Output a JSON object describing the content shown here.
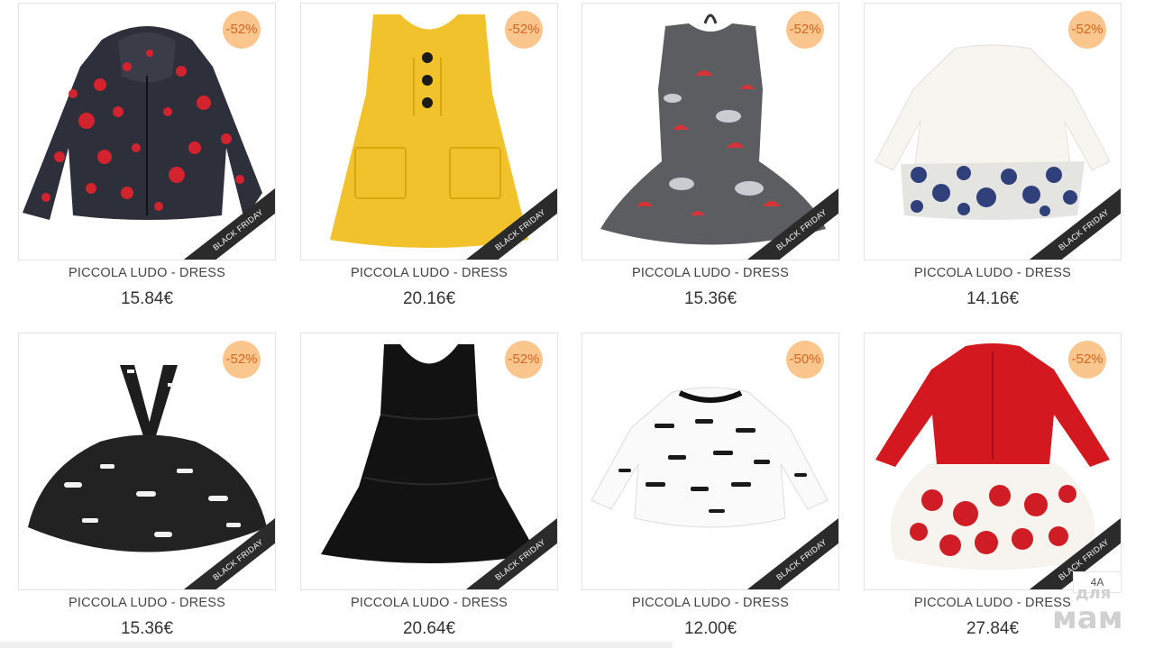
{
  "products": [
    {
      "title": "PICCOLA LUDO - DRESS",
      "price": "15.84€",
      "discount": "-52%",
      "ribbon": "BLACK FRIDAY",
      "image": "polka-dot-hoodie"
    },
    {
      "title": "PICCOLA LUDO - DRESS",
      "price": "20.16€",
      "discount": "-52%",
      "ribbon": "BLACK FRIDAY",
      "image": "yellow-pinafore-dress"
    },
    {
      "title": "PICCOLA LUDO - DRESS",
      "price": "15.36€",
      "discount": "-52%",
      "ribbon": "BLACK FRIDAY",
      "image": "grey-umbrella-dress"
    },
    {
      "title": "PICCOLA LUDO - DRESS",
      "price": "14.16€",
      "discount": "-52%",
      "ribbon": "BLACK FRIDAY",
      "image": "white-rose-dress"
    },
    {
      "title": "PICCOLA LUDO - DRESS",
      "price": "15.36€",
      "discount": "-52%",
      "ribbon": "BLACK FRIDAY",
      "image": "black-suspender-skirt"
    },
    {
      "title": "PICCOLA LUDO - DRESS",
      "price": "20.64€",
      "discount": "-52%",
      "ribbon": "BLACK FRIDAY",
      "image": "black-velvet-dress"
    },
    {
      "title": "PICCOLA LUDO - DRESS",
      "price": "12.00€",
      "discount": "-50%",
      "ribbon": "BLACK FRIDAY",
      "image": "dachshund-print-top"
    },
    {
      "title": "PICCOLA LUDO - DRESS",
      "price": "27.84€",
      "discount": "-52%",
      "ribbon": "BLACK FRIDAY",
      "image": "red-heart-tulle-dress"
    }
  ],
  "size_chip": "4A",
  "watermark": {
    "line1": "для",
    "line2": "мам"
  },
  "colors": {
    "discount_bg": "#fbc58e",
    "discount_text": "#d4661f",
    "ribbon": "#2b2b2b"
  }
}
